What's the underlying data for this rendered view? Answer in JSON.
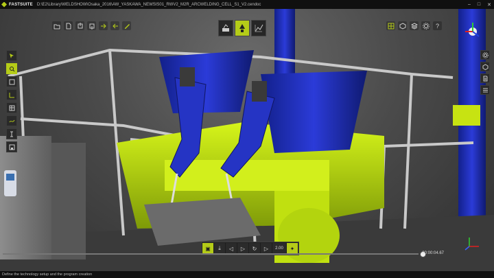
{
  "app": {
    "name": "FASTSUITE",
    "file_path": "D:\\E2\\Library\\WELDSHOW\\Osaka_2016\\AW_YASKAWA_NEWSIS01_RWV2_M2R_ARCWELDING_CELL_S1_V2.cendoc"
  },
  "window_controls": [
    "–",
    "□",
    "✕"
  ],
  "toolbar_left": [
    {
      "icon": "open-folder-icon"
    },
    {
      "icon": "new-document-icon"
    },
    {
      "icon": "import-icon"
    },
    {
      "icon": "export-icon"
    },
    {
      "icon": "forward-icon"
    },
    {
      "icon": "backward-icon"
    },
    {
      "icon": "edit-pencil-icon"
    }
  ],
  "toolbar_modes": [
    {
      "icon": "robot-setup-icon",
      "active": false
    },
    {
      "icon": "weld-technology-icon",
      "active": true
    },
    {
      "icon": "path-chart-icon",
      "active": false
    }
  ],
  "toolbar_right": [
    {
      "icon": "grid-view-icon"
    },
    {
      "icon": "cube-view-icon"
    },
    {
      "icon": "layers-icon"
    },
    {
      "icon": "settings-gear-icon"
    },
    {
      "icon": "help-icon",
      "glyph": "?"
    }
  ],
  "left_tools": [
    {
      "icon": "select-arrow-icon",
      "active": false
    },
    {
      "icon": "zoom-select-icon",
      "active": true
    },
    {
      "icon": "frame-icon",
      "active": false
    },
    {
      "icon": "move-axis-icon",
      "active": false
    },
    {
      "icon": "table-icon",
      "active": false
    },
    {
      "icon": "curve-icon",
      "active": false
    },
    {
      "icon": "measure-icon",
      "active": false
    },
    {
      "icon": "save-view-icon",
      "active": false
    }
  ],
  "right_tools": [
    {
      "icon": "gear-icon"
    },
    {
      "icon": "box-icon"
    },
    {
      "icon": "document-icon"
    },
    {
      "icon": "list-icon"
    }
  ],
  "playback": {
    "speed": "2.00",
    "controls": [
      "camera-icon",
      "download-icon",
      "step-back-icon",
      "play-icon",
      "loop-icon",
      "step-forward-icon"
    ]
  },
  "timeline": {
    "time": "00:00:04.67",
    "progress": 0.87
  },
  "status": {
    "text": "Define the technology setup and the program creation"
  },
  "colors": {
    "accent": "#b5cc18",
    "robot_blue": "#1f2ab8",
    "fixture_green": "#b8e000"
  }
}
